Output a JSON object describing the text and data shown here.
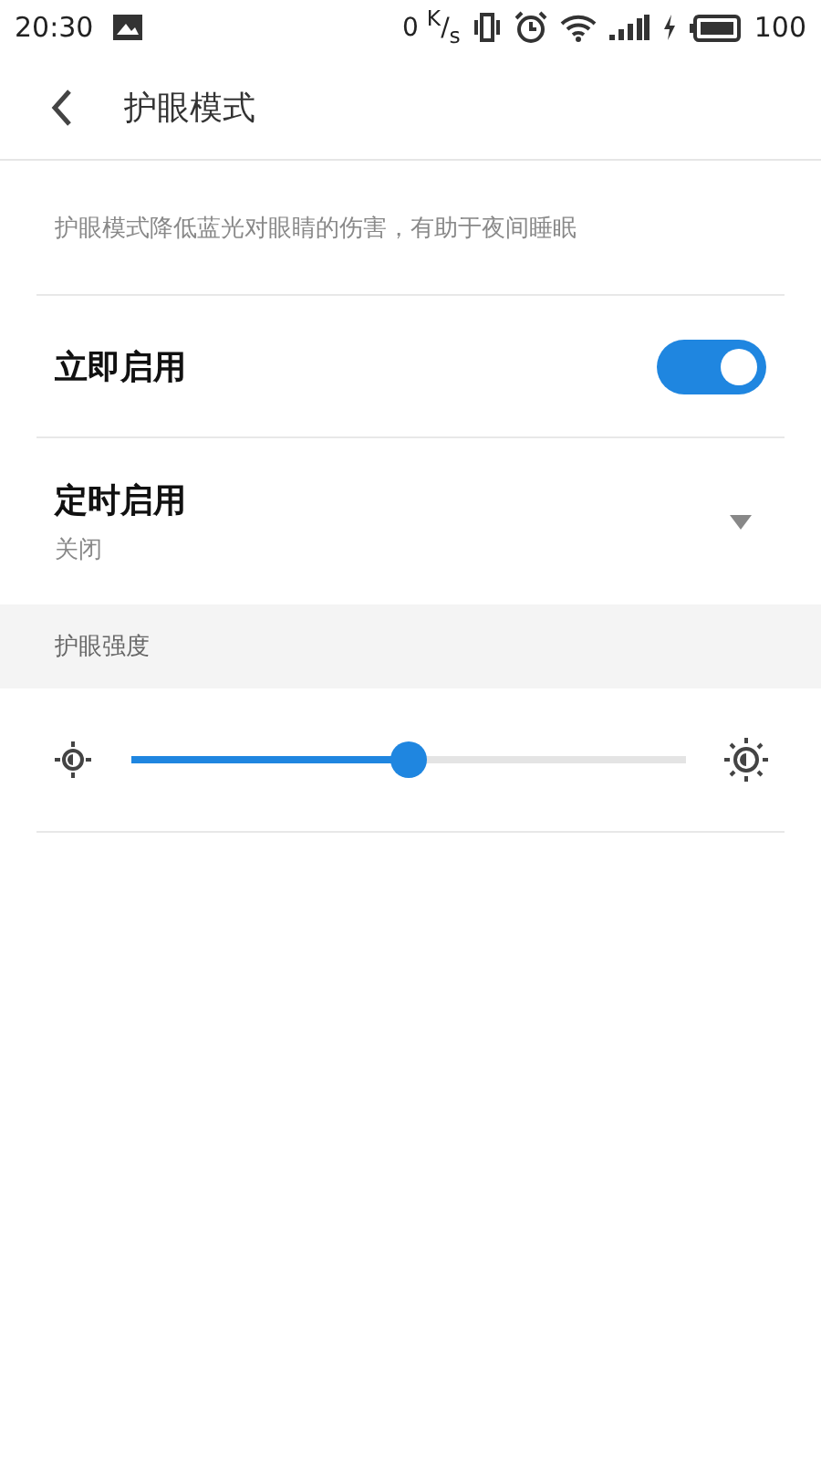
{
  "status_bar": {
    "time": "20:30",
    "speed": "0 $^{K}$/$_{s}$",
    "battery": "100"
  },
  "header": {
    "title": "护眼模式"
  },
  "description": "护眼模式降低蓝光对眼睛的伤害，有助于夜间睡眠",
  "settings": [
    {
      "kind": "switch",
      "label": "立即启用",
      "on": true
    },
    {
      "kind": "dropdown",
      "label": "定时启用",
      "value": "关闭"
    }
  ],
  "section": {
    "title": "护眼强度"
  },
  "intensity": {
    "level": 0.5
  }
}
